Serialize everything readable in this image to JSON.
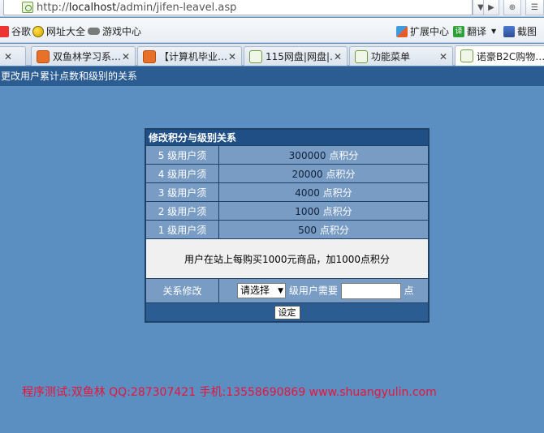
{
  "browser": {
    "url_prefix": "http://",
    "url_host": "localhost",
    "url_path": "/admin/jifen-leavel.asp",
    "bookmarks": [
      {
        "label": "谷歌"
      },
      {
        "label": "网址大全"
      },
      {
        "label": "游戏中心"
      },
      {
        "label": "扩展中心"
      },
      {
        "label": "翻译"
      },
      {
        "label": "截图"
      }
    ],
    "tabs": [
      {
        "label": "双鱼林学习系…",
        "close": "✕"
      },
      {
        "label": "【计算机毕业…",
        "close": "✕"
      },
      {
        "label": "115网盘|网盘|…",
        "close": "✕"
      },
      {
        "label": "功能菜单",
        "close": "✕"
      },
      {
        "label": "诺豪B2C购物…"
      }
    ]
  },
  "page": {
    "header": "更改用户累计点数和级别的关系",
    "table": {
      "caption": "修改积分与级别关系",
      "levels": [
        {
          "label": "5 级用户须",
          "points": "300000",
          "unit": "点积分"
        },
        {
          "label": "4 级用户须",
          "points": "20000",
          "unit": "点积分"
        },
        {
          "label": "3 级用户须",
          "points": "4000",
          "unit": "点积分"
        },
        {
          "label": "2 级用户须",
          "points": "1000",
          "unit": "点积分"
        },
        {
          "label": "1 级用户须",
          "points": "500",
          "unit": "点积分"
        }
      ],
      "note": "用户在站上每购买1000元商品，加1000点积分",
      "modify_label": "关系修改",
      "select_value": "请选择",
      "need_label": "级用户需要",
      "points_suffix": "点",
      "submit_label": "设定"
    },
    "footer": "程序测试:双鱼林 QQ:287307421 手机:13558690869 www.shuangyulin.com"
  }
}
